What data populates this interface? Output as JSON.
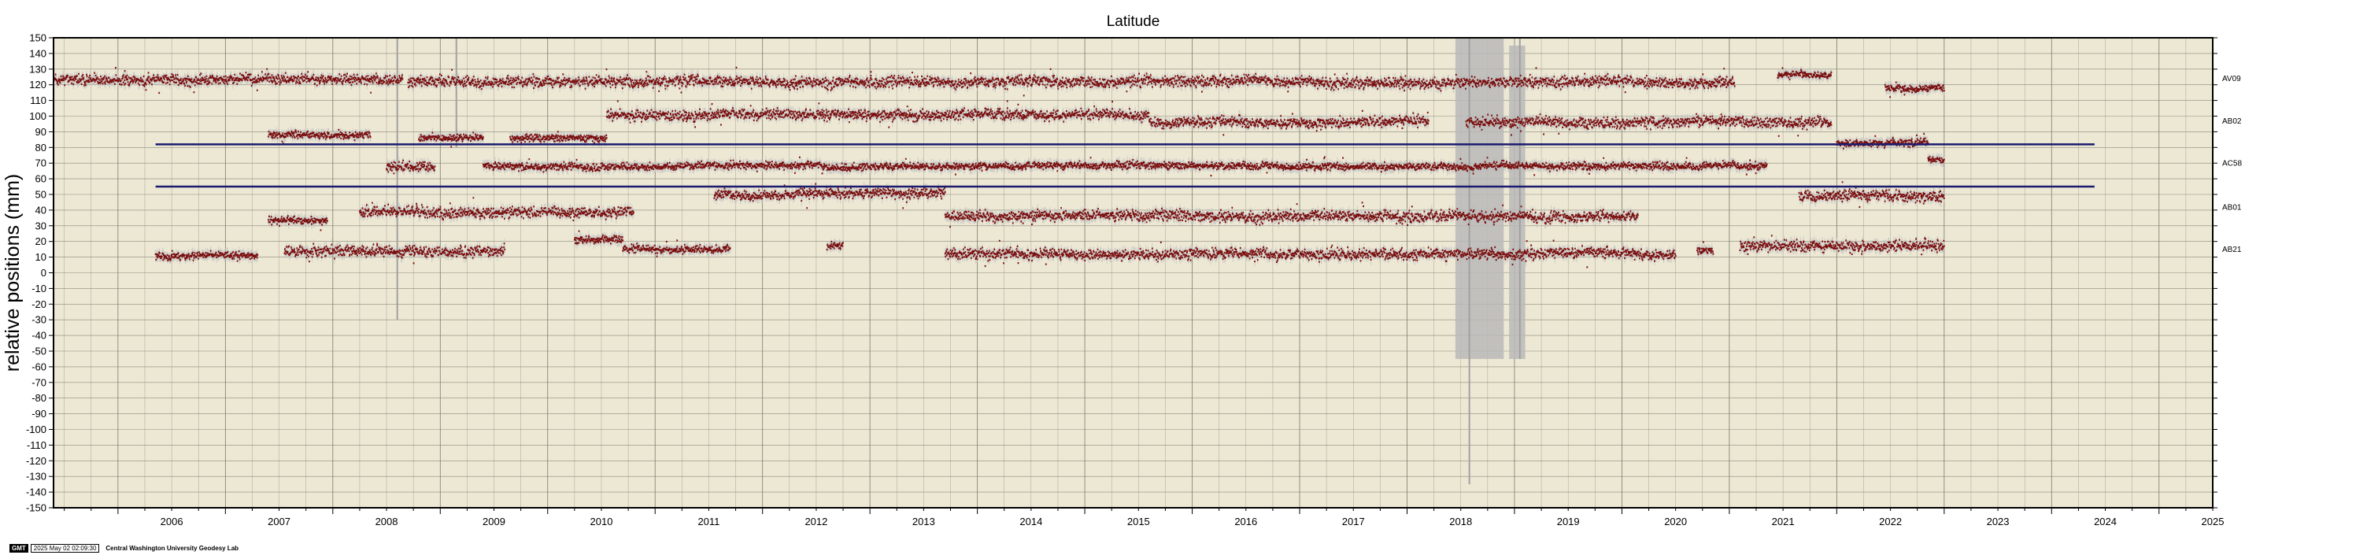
{
  "chart_data": {
    "type": "scatter",
    "title": "Latitude",
    "xlabel": "",
    "ylabel": "relative positions (mm)",
    "xlim": [
      2005.4,
      2025.5
    ],
    "ylim": [
      -150,
      150
    ],
    "ytick_step": 10,
    "xticks": [
      2006,
      2007,
      2008,
      2009,
      2010,
      2011,
      2012,
      2013,
      2014,
      2015,
      2016,
      2017,
      2018,
      2019,
      2020,
      2021,
      2022,
      2023,
      2024,
      2025
    ],
    "grid": true,
    "background_color": "#ede8d4",
    "point_color": "#7a0d0d",
    "error_color": "#c4c4c4",
    "reference_line_color": "#1a1a6e",
    "series": [
      {
        "name": "AV09",
        "label_y": 124,
        "segments": [
          {
            "x": [
              2005.4,
              2008.65
            ],
            "y": 123,
            "noise": 3
          },
          {
            "x": [
              2008.7,
              2021.05
            ],
            "y": 122,
            "noise": 3
          },
          {
            "x": [
              2021.45,
              2021.95
            ],
            "y": 126,
            "noise": 2
          },
          {
            "x": [
              2022.45,
              2023.0
            ],
            "y": 118,
            "noise": 2
          }
        ]
      },
      {
        "name": "AB02",
        "label_y": 97,
        "segments": [
          {
            "x": [
              2007.4,
              2008.35
            ],
            "y": 88,
            "noise": 2
          },
          {
            "x": [
              2008.8,
              2009.4
            ],
            "y": 86,
            "noise": 2
          },
          {
            "x": [
              2009.65,
              2010.55
            ],
            "y": 86,
            "noise": 2
          },
          {
            "x": [
              2010.55,
              2015.6
            ],
            "y": 101,
            "noise": 3
          },
          {
            "x": [
              2015.6,
              2018.2
            ],
            "y": 96,
            "noise": 3
          },
          {
            "x": [
              2018.55,
              2021.95
            ],
            "y": 96,
            "noise": 3
          },
          {
            "x": [
              2022.0,
              2022.85
            ],
            "y": 83,
            "noise": 2
          }
        ]
      },
      {
        "name": "AC58",
        "label_y": 70,
        "segments": [
          {
            "x": [
              2008.5,
              2008.95
            ],
            "y": 67,
            "noise": 3
          },
          {
            "x": [
              2009.4,
              2021.35
            ],
            "y": 68,
            "noise": 2
          },
          {
            "x": [
              2022.85,
              2023.0
            ],
            "y": 72,
            "noise": 2
          }
        ]
      },
      {
        "name": "AB01",
        "label_y": 42,
        "segments": [
          {
            "x": [
              2007.4,
              2007.95
            ],
            "y": 33,
            "noise": 2
          },
          {
            "x": [
              2008.25,
              2010.8
            ],
            "y": 39,
            "noise": 3
          },
          {
            "x": [
              2011.55,
              2013.7
            ],
            "y": 50,
            "noise": 3
          },
          {
            "x": [
              2013.7,
              2020.15
            ],
            "y": 36,
            "noise": 3
          },
          {
            "x": [
              2021.65,
              2023.0
            ],
            "y": 49,
            "noise": 3
          }
        ]
      },
      {
        "name": "AB21",
        "label_y": 15,
        "segments": [
          {
            "x": [
              2006.35,
              2006.5
            ],
            "y": 10,
            "noise": 2
          },
          {
            "x": [
              2006.5,
              2007.3
            ],
            "y": 11,
            "noise": 2
          },
          {
            "x": [
              2007.55,
              2009.6
            ],
            "y": 14,
            "noise": 3
          },
          {
            "x": [
              2010.25,
              2010.7
            ],
            "y": 21,
            "noise": 2
          },
          {
            "x": [
              2010.7,
              2011.7
            ],
            "y": 15,
            "noise": 2
          },
          {
            "x": [
              2012.6,
              2012.75
            ],
            "y": 17,
            "noise": 2
          },
          {
            "x": [
              2013.7,
              2020.5
            ],
            "y": 12,
            "noise": 3
          },
          {
            "x": [
              2020.7,
              2020.85
            ],
            "y": 14,
            "noise": 2
          },
          {
            "x": [
              2021.1,
              2023.0
            ],
            "y": 17,
            "noise": 3
          }
        ]
      }
    ],
    "reference_lines": [
      {
        "y": 82,
        "x": [
          2006.35,
          2024.4
        ]
      },
      {
        "y": 55,
        "x": [
          2006.35,
          2024.4
        ]
      }
    ],
    "outlier_spikes": [
      {
        "x": 2008.6,
        "y_min": -30,
        "y_max": 150
      },
      {
        "x": 2009.15,
        "y_min": 80,
        "y_max": 150
      },
      {
        "x": 2018.58,
        "y_min": -135,
        "y_max": 150
      },
      {
        "x": 2019.05,
        "y_min": -55,
        "y_max": 150
      }
    ],
    "error_blocks": [
      {
        "x": [
          2018.45,
          2018.9
        ],
        "y_min": -55,
        "y_max": 150
      },
      {
        "x": [
          2018.95,
          2019.1
        ],
        "y_min": -55,
        "y_max": 145
      }
    ]
  },
  "footer": {
    "logo": "GMT",
    "timestamp": "2025 May 02 02:09:30",
    "credit": "Central Washington University Geodesy Lab"
  }
}
